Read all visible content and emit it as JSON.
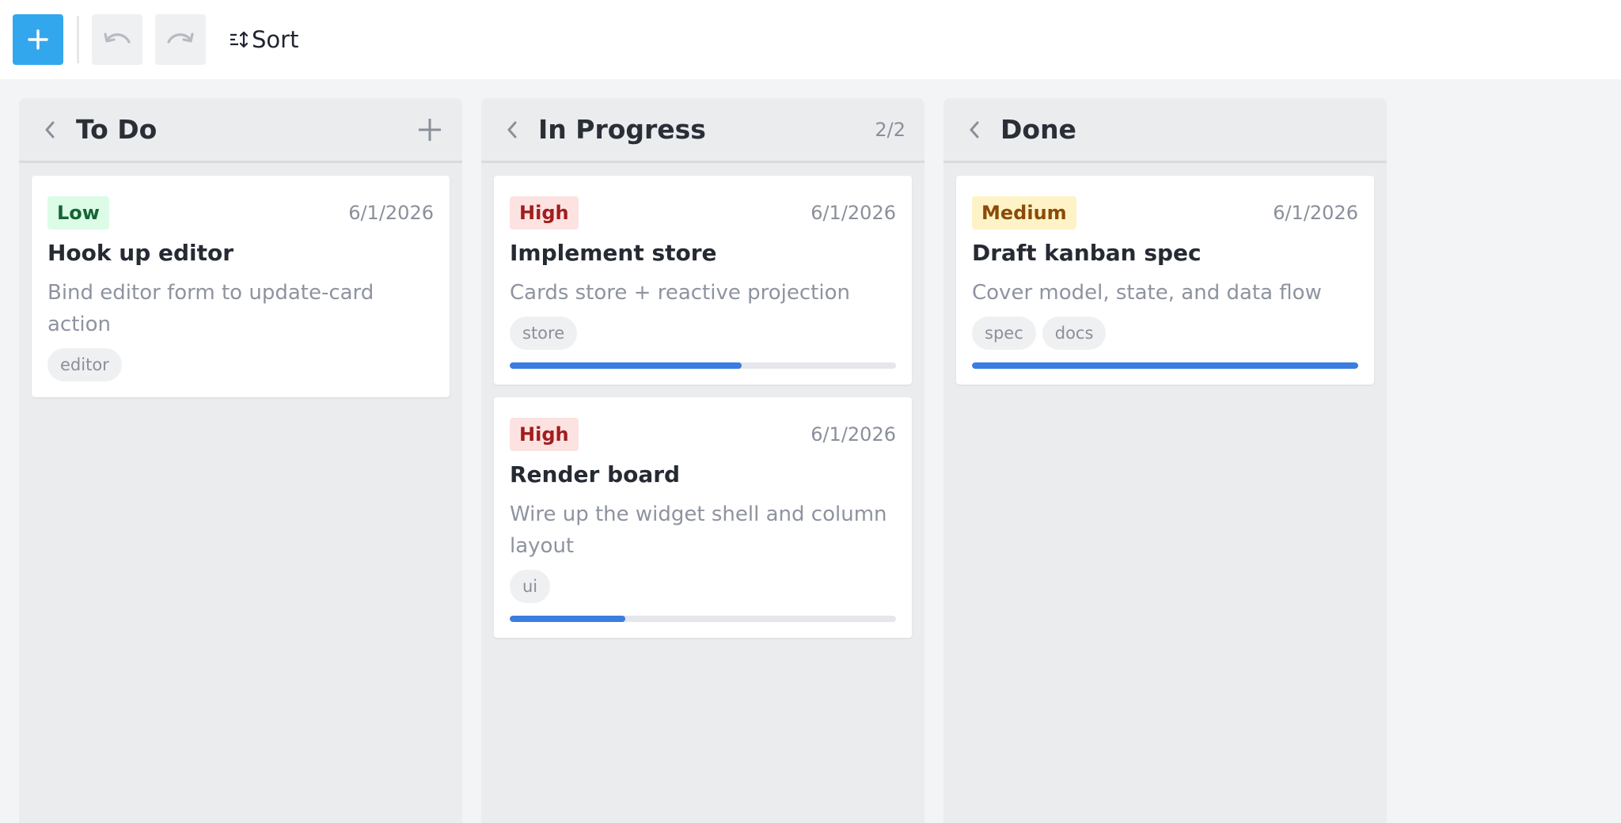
{
  "toolbar": {
    "sort_label": "Sort"
  },
  "colors": {
    "accent": "#33a7ee",
    "progress": "#3b7de0"
  },
  "columns": [
    {
      "title": "To Do",
      "count": "",
      "cards": [
        {
          "priority": "Low",
          "date": "6/1/2026",
          "title": "Hook up editor",
          "description": "Bind editor form to update-card action",
          "tags": [
            "editor"
          ],
          "progress": null
        }
      ]
    },
    {
      "title": "In Progress",
      "count": "2/2",
      "cards": [
        {
          "priority": "High",
          "date": "6/1/2026",
          "title": "Implement store",
          "description": "Cards store + reactive projection",
          "tags": [
            "store"
          ],
          "progress": 0.6
        },
        {
          "priority": "High",
          "date": "6/1/2026",
          "title": "Render board",
          "description": "Wire up the widget shell and column layout",
          "tags": [
            "ui"
          ],
          "progress": 0.3
        }
      ]
    },
    {
      "title": "Done",
      "count": "",
      "cards": [
        {
          "priority": "Medium",
          "date": "6/1/2026",
          "title": "Draft kanban spec",
          "description": "Cover model, state, and data flow",
          "tags": [
            "spec",
            "docs"
          ],
          "progress": 1.0
        }
      ]
    }
  ]
}
